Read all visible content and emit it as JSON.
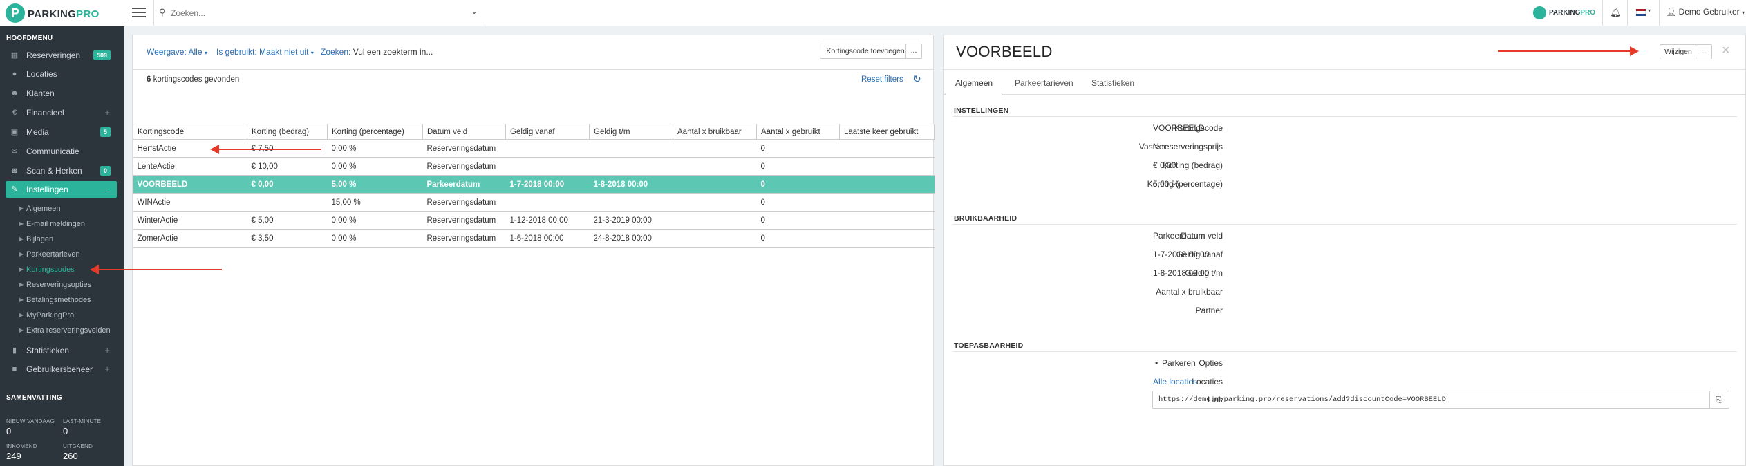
{
  "logo": {
    "mark": "P",
    "text_a": "PARKING",
    "text_b": "PRO"
  },
  "topbar": {
    "search_placeholder": "Zoeken...",
    "user": "Demo Gebruiker",
    "brand_a": "PARKING",
    "brand_b": "PRO"
  },
  "sidebar": {
    "section_title": "HOOFDMENU",
    "items": [
      {
        "label": "Reserveringen",
        "badge": "509"
      },
      {
        "label": "Locaties"
      },
      {
        "label": "Klanten"
      },
      {
        "label": "Financieel",
        "plus": "+"
      },
      {
        "label": "Media",
        "badge": "5"
      },
      {
        "label": "Communicatie"
      },
      {
        "label": "Scan & Herken",
        "badge": "0"
      },
      {
        "label": "Instellingen",
        "plus": "−"
      },
      {
        "label": "Statistieken",
        "plus": "+"
      },
      {
        "label": "Gebruikersbeheer",
        "plus": "+"
      }
    ],
    "subitems": [
      "Algemeen",
      "E-mail meldingen",
      "Bijlagen",
      "Parkeertarieven",
      "Kortingscodes",
      "Reserveringsopties",
      "Betalingsmethodes",
      "MyParkingPro",
      "Extra reserveringsvelden"
    ],
    "summary_title": "SAMENVATTING",
    "summary": [
      {
        "label": "NIEUW VANDAAG",
        "value": "0"
      },
      {
        "label": "LAST-MINUTE",
        "value": "0"
      },
      {
        "label": "INKOMEND",
        "value": "249"
      },
      {
        "label": "UITGAEND",
        "value": "260"
      }
    ]
  },
  "list": {
    "filters": {
      "weergave_k": "Weergave:",
      "weergave_v": "Alle",
      "gebruikt_k": "Is gebruikt:",
      "gebruikt_v": "Maakt niet uit",
      "zoeken_k": "Zoeken:",
      "zoeken_v": "Vul een zoekterm in..."
    },
    "add_button": "Kortingscode toevoegen",
    "more_button": "...",
    "count_text": "6 kortingscodes gevonden",
    "count_num": "6",
    "count_rest": " kortingscodes gevonden",
    "reset": "Reset filters",
    "columns": [
      "Kortingscode",
      "Korting (bedrag)",
      "Korting (percentage)",
      "Datum veld",
      "Geldig vanaf",
      "Geldig t/m",
      "Aantal x bruikbaar",
      "Aantal x gebruikt",
      "Laatste keer gebruikt"
    ],
    "rows": [
      [
        "HerfstActie",
        "€ 7,50",
        "0,00 %",
        "Reserveringsdatum",
        "",
        "",
        "",
        "0",
        ""
      ],
      [
        "LenteActie",
        "€ 10,00",
        "0,00 %",
        "Reserveringsdatum",
        "",
        "",
        "",
        "0",
        ""
      ],
      [
        "VOORBEELD",
        "€ 0,00",
        "5,00 %",
        "Parkeerdatum",
        "1-7-2018 00:00",
        "1-8-2018 00:00",
        "",
        "0",
        ""
      ],
      [
        "WINActie",
        "",
        "15,00 %",
        "Reserveringsdatum",
        "",
        "",
        "",
        "0",
        ""
      ],
      [
        "WinterActie",
        "€ 5,00",
        "0,00 %",
        "Reserveringsdatum",
        "1-12-2018 00:00",
        "21-3-2019 00:00",
        "",
        "0",
        ""
      ],
      [
        "ZomerActie",
        "€ 3,50",
        "0,00 %",
        "Reserveringsdatum",
        "1-6-2018 00:00",
        "24-8-2018 00:00",
        "",
        "0",
        ""
      ]
    ]
  },
  "detail": {
    "title": "VOORBEELD",
    "edit_button": "Wijzigen",
    "more_button": "...",
    "close": "×",
    "tabs": [
      "Algemeen",
      "Parkeertarieven",
      "Statistieken"
    ],
    "sec1": "INSTELLINGEN",
    "sec1_rows": [
      {
        "k": "Kortingscode",
        "v": "VOORBEELD"
      },
      {
        "k": "Vaste reserveringsprijs",
        "v": "Nee"
      },
      {
        "k": "Korting (bedrag)",
        "v": "€ 0,00"
      },
      {
        "k": "Korting (percentage)",
        "v": "5,00 %"
      }
    ],
    "sec2": "BRUIKBAARHEID",
    "sec2_rows": [
      {
        "k": "Datum veld",
        "v": "Parkeerdatum"
      },
      {
        "k": "Geldig vanaf",
        "v": "1-7-2018 00:00"
      },
      {
        "k": "Geldig t/m",
        "v": "1-8-2018 00:00"
      },
      {
        "k": "Aantal x bruikbaar",
        "v": ""
      },
      {
        "k": "Partner",
        "v": ""
      }
    ],
    "sec3": "TOEPASBAARHEID",
    "opties_k": "Opties",
    "opties_v": "Parkeren",
    "locaties_k": "Locaties",
    "locaties_v": "Alle locaties",
    "link_k": "Link",
    "link_v": "https://demo.myparking.pro/reservations/add?discountCode=VOORBEELD"
  },
  "colors": {
    "accent": "#2bb49b",
    "sidebar": "#2d353c",
    "arrow": "#e53a2a",
    "link": "#2a6fb3"
  }
}
